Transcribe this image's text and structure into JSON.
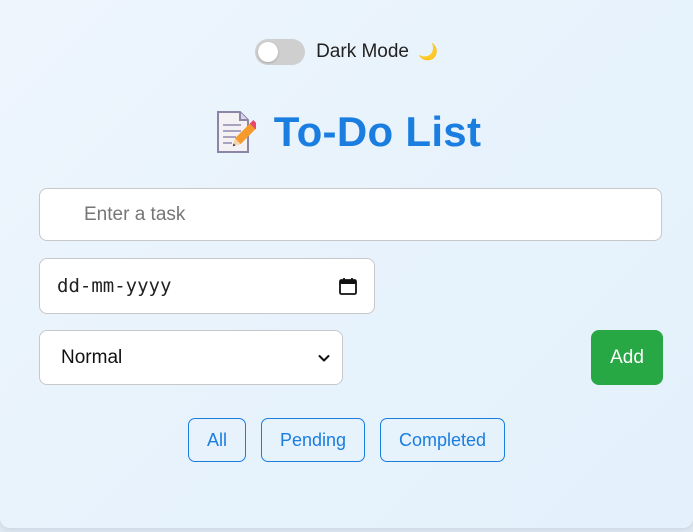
{
  "app": {
    "accent_color": "#1a7de0",
    "add_color": "#28a745"
  },
  "toggle": {
    "label": "Dark Mode",
    "icon": "🌙",
    "on": false
  },
  "header": {
    "icon": "memo-icon",
    "title": "To-Do List"
  },
  "form": {
    "task_placeholder": "Enter a task",
    "task_value": "",
    "date_placeholder": "dd-mm-yyyy",
    "priority_selected": "Normal",
    "add_label": "Add"
  },
  "filters": [
    {
      "label": "All"
    },
    {
      "label": "Pending"
    },
    {
      "label": "Completed"
    }
  ]
}
